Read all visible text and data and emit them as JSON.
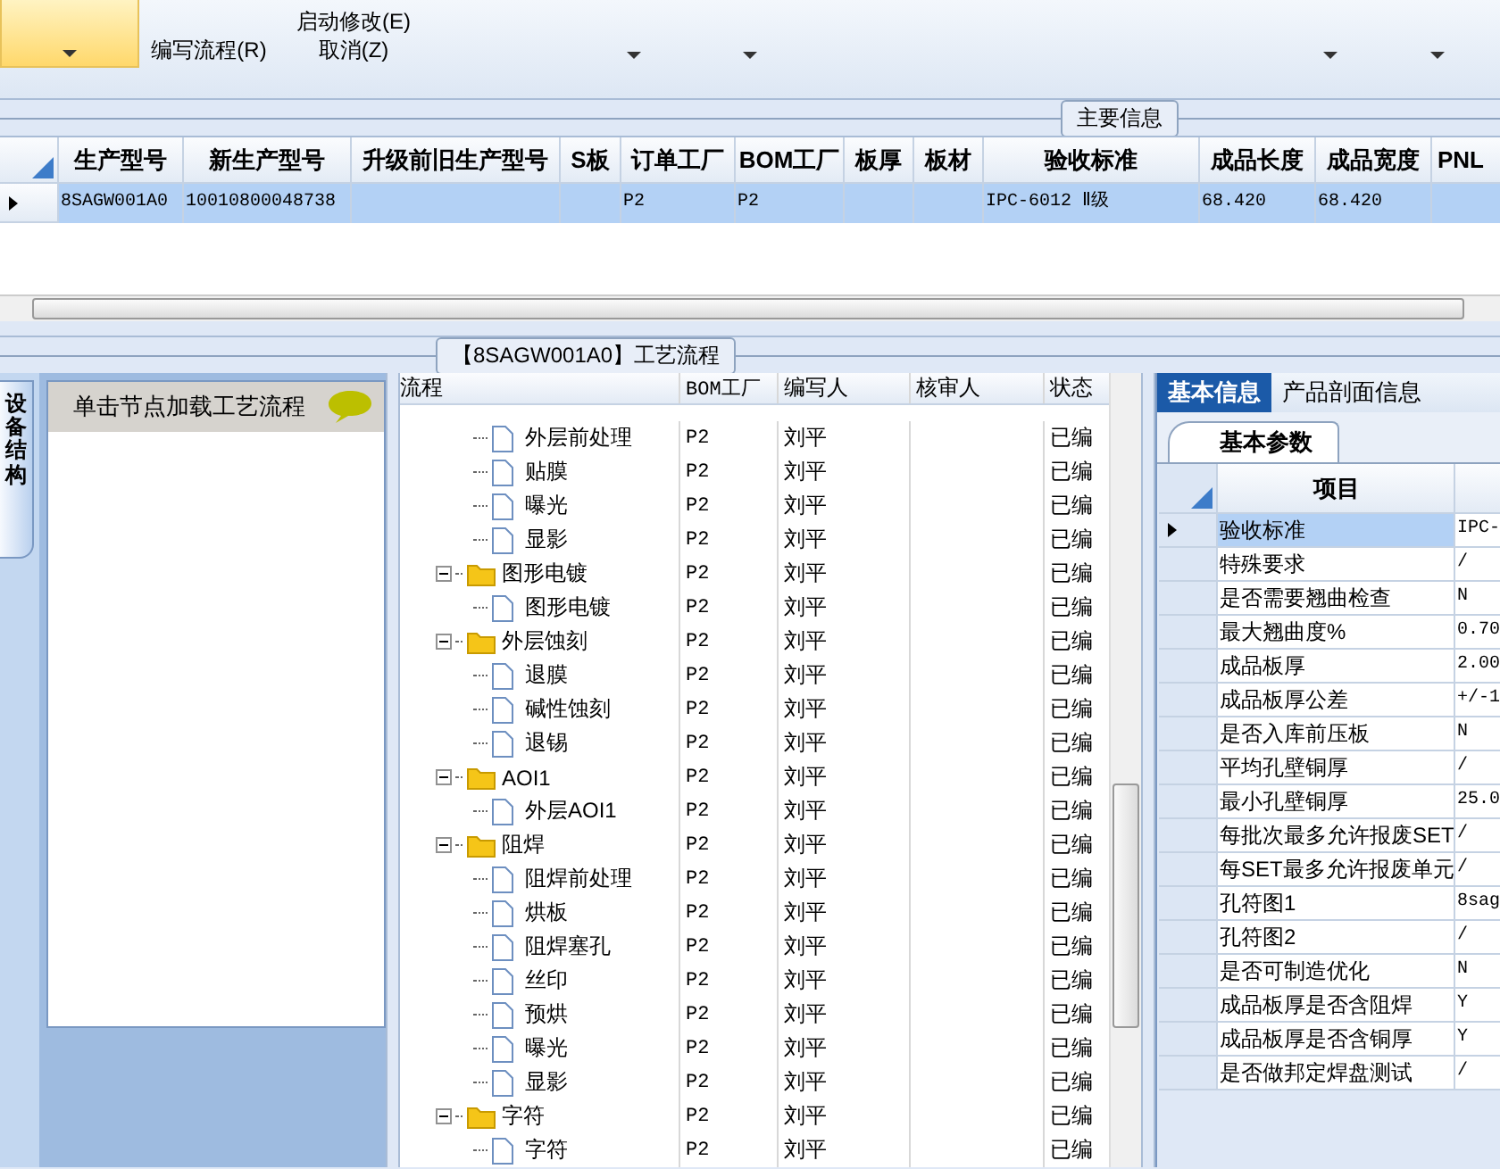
{
  "toolbar": {
    "items": [
      {
        "kind": "dropdown",
        "selected": true
      },
      {
        "kind": "button",
        "selected": false,
        "label": "编写流程(R)"
      },
      {
        "kind": "button",
        "selected": false,
        "label": "启动修改(E)",
        "label2": "取消(Z)"
      },
      {
        "kind": "dropdown",
        "selected": false
      },
      {
        "kind": "dropdown",
        "selected": false
      },
      {
        "kind": "dropdown",
        "selected": false
      },
      {
        "kind": "dropdown",
        "selected": false
      }
    ]
  },
  "main_section": {
    "title": "主要信息"
  },
  "main_table": {
    "columns": [
      "生产型号",
      "新生产型号",
      "升级前旧生产型号",
      "S板",
      "订单工厂",
      "BOM工厂",
      "板厚",
      "板材",
      "验收标准",
      "成品长度",
      "成品宽度",
      "PNL"
    ],
    "rows": [
      {
        "selected": true,
        "cells": [
          "8SAGW001A0",
          "10010800048738",
          "",
          "",
          "P2",
          "P2",
          "",
          "",
          "IPC-6012 Ⅱ级",
          "68.420",
          "68.420",
          ""
        ]
      }
    ]
  },
  "flow_section": {
    "title": "【8SAGW001A0】工艺流程"
  },
  "side_tab": {
    "label": "设备结构"
  },
  "equipment_panel": {
    "header": "单击节点加载工艺流程"
  },
  "flow_tree": {
    "columns": [
      "流程",
      "BOM工厂",
      "编写人",
      "核审人",
      "状态"
    ],
    "groups": [
      {
        "children": [
          {
            "name": "外层前处理",
            "bom": "P2",
            "author": "刘平",
            "status": "已编"
          },
          {
            "name": "贴膜",
            "bom": "P2",
            "author": "刘平",
            "status": "已编"
          },
          {
            "name": "曝光",
            "bom": "P2",
            "author": "刘平",
            "status": "已编"
          },
          {
            "name": "显影",
            "bom": "P2",
            "author": "刘平",
            "status": "已编"
          }
        ]
      },
      {
        "name": "图形电镀",
        "bom": "P2",
        "author": "刘平",
        "status": "已编",
        "expanded": true,
        "children": [
          {
            "name": "图形电镀",
            "bom": "P2",
            "author": "刘平",
            "status": "已编"
          }
        ]
      },
      {
        "name": "外层蚀刻",
        "bom": "P2",
        "author": "刘平",
        "status": "已编",
        "expanded": true,
        "children": [
          {
            "name": "退膜",
            "bom": "P2",
            "author": "刘平",
            "status": "已编"
          },
          {
            "name": "碱性蚀刻",
            "bom": "P2",
            "author": "刘平",
            "status": "已编"
          },
          {
            "name": "退锡",
            "bom": "P2",
            "author": "刘平",
            "status": "已编"
          }
        ]
      },
      {
        "name": "AOI1",
        "bom": "P2",
        "author": "刘平",
        "status": "已编",
        "expanded": true,
        "children": [
          {
            "name": "外层AOI1",
            "bom": "P2",
            "author": "刘平",
            "status": "已编"
          }
        ]
      },
      {
        "name": "阻焊",
        "bom": "P2",
        "author": "刘平",
        "status": "已编",
        "expanded": true,
        "children": [
          {
            "name": "阻焊前处理",
            "bom": "P2",
            "author": "刘平",
            "status": "已编"
          },
          {
            "name": "烘板",
            "bom": "P2",
            "author": "刘平",
            "status": "已编"
          },
          {
            "name": "阻焊塞孔",
            "bom": "P2",
            "author": "刘平",
            "status": "已编"
          },
          {
            "name": "丝印",
            "bom": "P2",
            "author": "刘平",
            "status": "已编"
          },
          {
            "name": "预烘",
            "bom": "P2",
            "author": "刘平",
            "status": "已编"
          },
          {
            "name": "曝光",
            "bom": "P2",
            "author": "刘平",
            "status": "已编"
          },
          {
            "name": "显影",
            "bom": "P2",
            "author": "刘平",
            "status": "已编"
          }
        ]
      },
      {
        "name": "字符",
        "bom": "P2",
        "author": "刘平",
        "status": "已编",
        "expanded": true,
        "children": [
          {
            "name": "字符",
            "bom": "P2",
            "author": "刘平",
            "status": "已编"
          }
        ]
      }
    ]
  },
  "info_tabs": [
    {
      "label": "基本信息",
      "selected": true
    },
    {
      "label": "产品剖面信息",
      "selected": false
    }
  ],
  "param_tab": {
    "label": "基本参数",
    "selected": true
  },
  "param_table": {
    "columns": [
      "项目"
    ],
    "rows": [
      {
        "name": "验收标准",
        "value": "IPC-",
        "selected": true
      },
      {
        "name": "特殊要求",
        "value": "/",
        "selected": false
      },
      {
        "name": "是否需要翘曲检查",
        "value": "N",
        "selected": false
      },
      {
        "name": "最大翘曲度%",
        "value": "0.70",
        "selected": false
      },
      {
        "name": "成品板厚",
        "value": "2.00",
        "selected": false
      },
      {
        "name": "成品板厚公差",
        "value": "+/-1",
        "selected": false
      },
      {
        "name": "是否入库前压板",
        "value": "N",
        "selected": false
      },
      {
        "name": "平均孔壁铜厚",
        "value": "/",
        "selected": false
      },
      {
        "name": "最小孔壁铜厚",
        "value": "25.0",
        "selected": false
      },
      {
        "name": "每批次最多允许报废SET",
        "value": "/",
        "selected": false
      },
      {
        "name": "每SET最多允许报废单元",
        "value": "/",
        "selected": false
      },
      {
        "name": "孔符图1",
        "value": "8sag",
        "selected": false
      },
      {
        "name": "孔符图2",
        "value": "/",
        "selected": false
      },
      {
        "name": "是否可制造优化",
        "value": "N",
        "selected": false
      },
      {
        "name": "成品板厚是否含阻焊",
        "value": "Y",
        "selected": false
      },
      {
        "name": "成品板厚是否含铜厚",
        "value": "Y",
        "selected": false
      },
      {
        "name": "是否做邦定焊盘测试",
        "value": "/",
        "selected": false
      }
    ]
  }
}
